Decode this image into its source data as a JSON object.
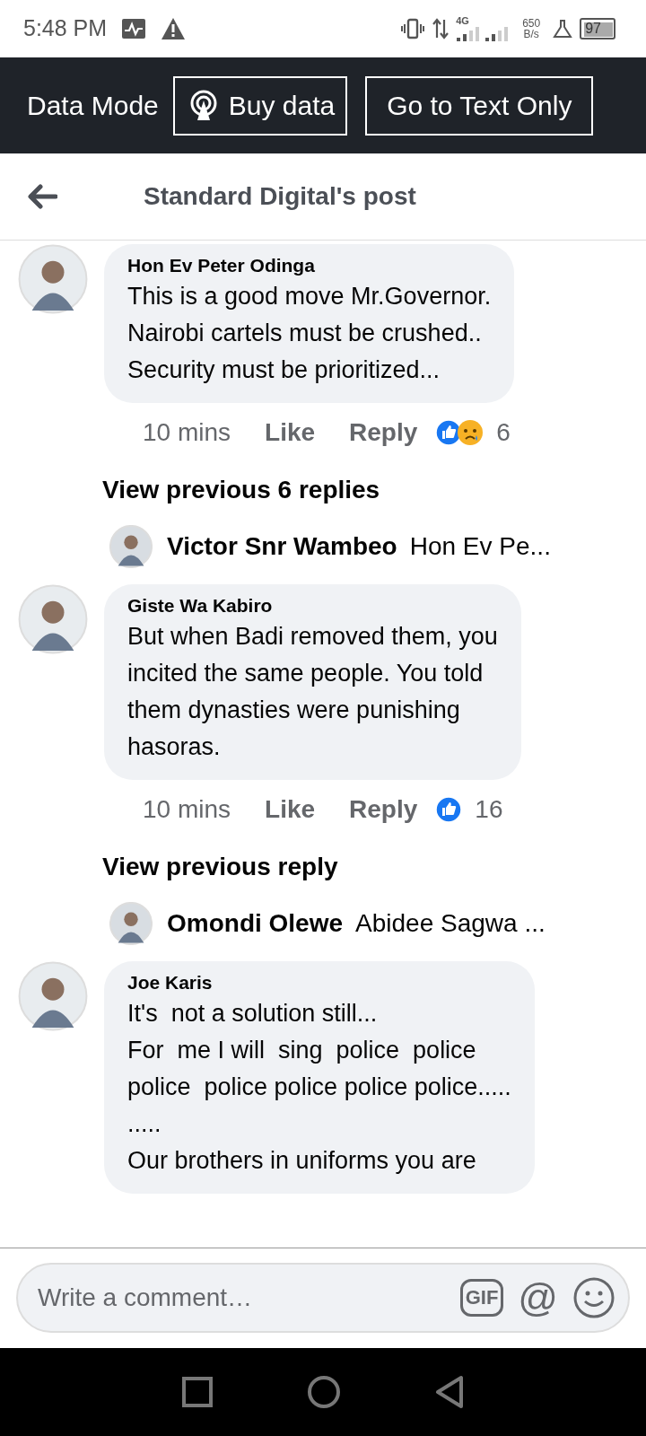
{
  "status_bar": {
    "time": "5:48 PM",
    "network": "4G",
    "speed": "650",
    "speed_unit": "B/s",
    "battery": "97"
  },
  "data_bar": {
    "label": "Data Mode",
    "buttons": [
      {
        "kind": "buy",
        "label": "Buy data"
      },
      {
        "kind": "text_only",
        "label": "Go to Text Only"
      }
    ]
  },
  "header": {
    "title": "Standard Digital's post"
  },
  "feed": [
    {
      "kind": "comment",
      "author": "Hon Ev Peter Odinga",
      "lines": [
        "This is a good move Mr.Governor.",
        "Nairobi cartels must be crushed..",
        "Security must be prioritized..."
      ],
      "time": "10 mins",
      "like": "Like",
      "reply": "Reply",
      "reactions": [
        {
          "kind": "like"
        },
        {
          "kind": "sad"
        }
      ],
      "reaction_count": "6"
    },
    {
      "kind": "view_more",
      "label": "View previous 6 replies"
    },
    {
      "kind": "reply_preview",
      "author": "Victor Snr Wambeo",
      "snippet": "Hon Ev Pe..."
    },
    {
      "kind": "comment",
      "author": "Giste Wa Kabiro",
      "lines": [
        "But when Badi removed them, you",
        "incited the same people. You told",
        "them dynasties were punishing",
        "hasoras."
      ],
      "time": "10 mins",
      "like": "Like",
      "reply": "Reply",
      "reactions": [
        {
          "kind": "like"
        }
      ],
      "reaction_count": "16"
    },
    {
      "kind": "view_more",
      "label": "View previous reply"
    },
    {
      "kind": "reply_preview",
      "author": "Omondi Olewe",
      "snippet": "Abidee Sagwa ..."
    },
    {
      "kind": "comment",
      "author": "Joe Karis",
      "lines": [
        "It's  not a solution still...",
        "For  me I will  sing  police  police",
        "police  police police police police.....",
        ".....",
        "Our brothers in uniforms you are"
      ]
    }
  ],
  "composer": {
    "placeholder": "Write a comment…",
    "gif": "GIF",
    "mention": "@"
  }
}
